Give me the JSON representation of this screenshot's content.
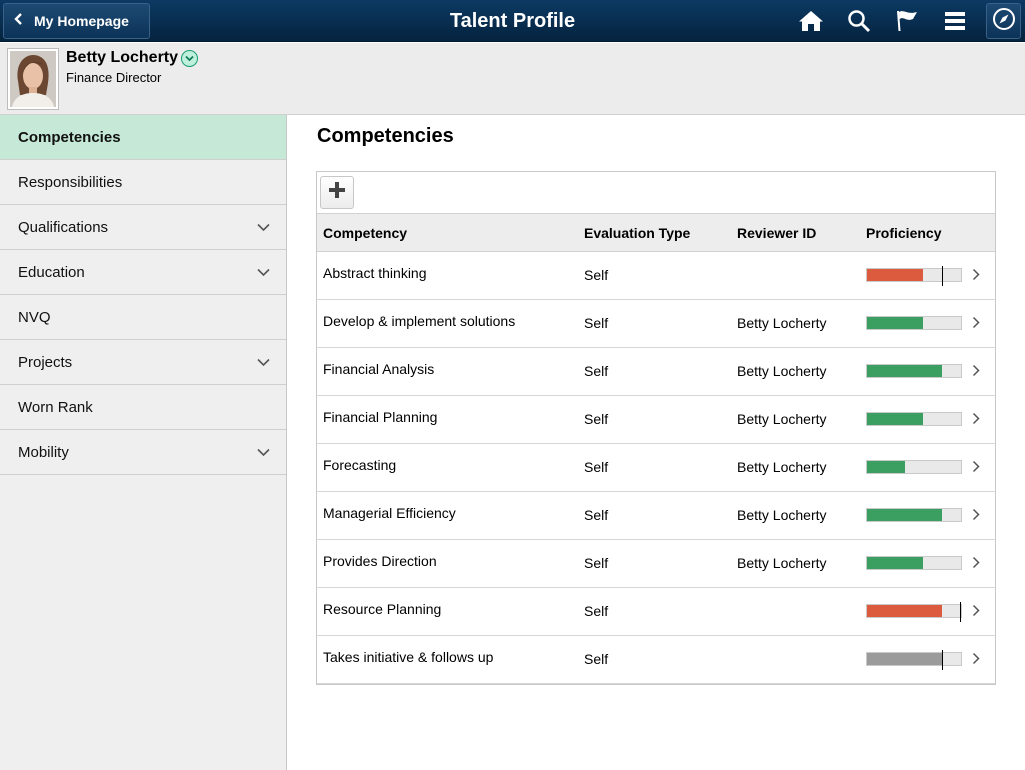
{
  "banner": {
    "back_label": "My Homepage",
    "title": "Talent Profile",
    "icons": [
      "home-icon",
      "search-icon",
      "flag-icon",
      "menu-icon",
      "compass-icon"
    ],
    "color": "#0a3359"
  },
  "profile": {
    "name": "Betty Locherty",
    "title": "Finance Director"
  },
  "sidebar": {
    "items": [
      {
        "label": "Competencies",
        "active": true,
        "expandable": false
      },
      {
        "label": "Responsibilities",
        "active": false,
        "expandable": false
      },
      {
        "label": "Qualifications",
        "active": false,
        "expandable": true
      },
      {
        "label": "Education",
        "active": false,
        "expandable": true
      },
      {
        "label": "NVQ",
        "active": false,
        "expandable": false
      },
      {
        "label": "Projects",
        "active": false,
        "expandable": true
      },
      {
        "label": "Worn Rank",
        "active": false,
        "expandable": false
      },
      {
        "label": "Mobility",
        "active": false,
        "expandable": true
      }
    ],
    "active_color": "#c6e8d6"
  },
  "main": {
    "title": "Competencies",
    "columns": [
      "Competency",
      "Evaluation Type",
      "Reviewer ID",
      "Proficiency"
    ],
    "rows": [
      {
        "competency": "Abstract thinking",
        "evaluation": "Self",
        "reviewer": "",
        "proficiency": 0.6,
        "target": 0.8,
        "status": "below"
      },
      {
        "competency": "Develop & implement solutions",
        "evaluation": "Self",
        "reviewer": "Betty Locherty",
        "proficiency": 0.6,
        "target": null,
        "status": "met"
      },
      {
        "competency": "Financial Analysis",
        "evaluation": "Self",
        "reviewer": "Betty Locherty",
        "proficiency": 0.8,
        "target": null,
        "status": "met"
      },
      {
        "competency": "Financial Planning",
        "evaluation": "Self",
        "reviewer": "Betty Locherty",
        "proficiency": 0.6,
        "target": null,
        "status": "met"
      },
      {
        "competency": "Forecasting",
        "evaluation": "Self",
        "reviewer": "Betty Locherty",
        "proficiency": 0.4,
        "target": null,
        "status": "met"
      },
      {
        "competency": "Managerial Efficiency",
        "evaluation": "Self",
        "reviewer": "Betty Locherty",
        "proficiency": 0.8,
        "target": null,
        "status": "met"
      },
      {
        "competency": "Provides Direction",
        "evaluation": "Self",
        "reviewer": "Betty Locherty",
        "proficiency": 0.6,
        "target": null,
        "status": "met"
      },
      {
        "competency": "Resource Planning",
        "evaluation": "Self",
        "reviewer": "",
        "proficiency": 0.8,
        "target": 1.0,
        "status": "below"
      },
      {
        "competency": "Takes initiative & follows up",
        "evaluation": "Self",
        "reviewer": "",
        "proficiency": 0.8,
        "target": 0.8,
        "status": "none"
      }
    ],
    "status_colors": {
      "met": "#3a9f60",
      "below": "#dc5a3e",
      "none": "#9b9b9b"
    }
  }
}
